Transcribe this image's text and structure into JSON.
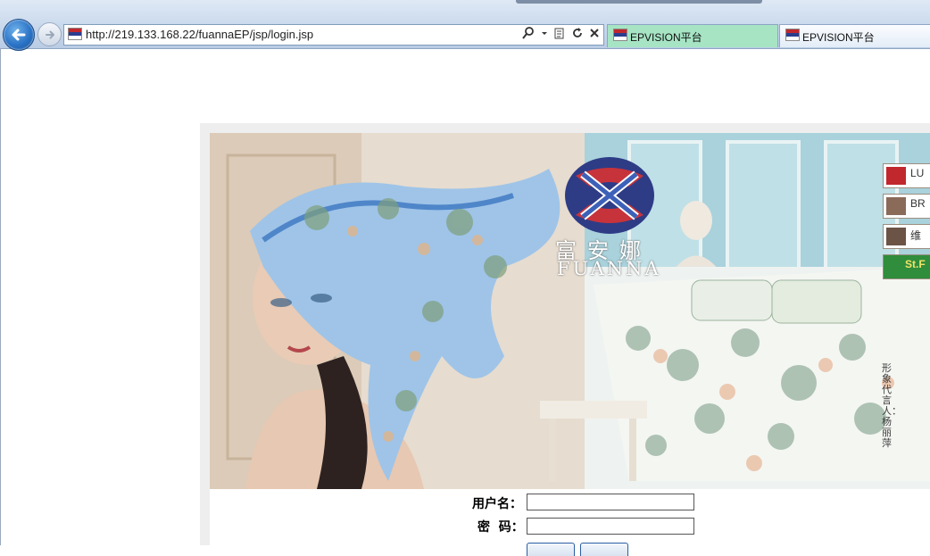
{
  "browser": {
    "address_url": "http://219.133.168.22/fuannaEP/jsp/login.jsp",
    "tabs": [
      {
        "label": "EPVISION平台"
      },
      {
        "label": "EPVISION平台"
      }
    ]
  },
  "banner": {
    "brand_name_cn": "富安娜",
    "brand_name_en": "FUANNA",
    "side_brands": [
      "LU",
      "BR",
      "维",
      "St.F"
    ],
    "vertical_caption": "形象代言人：杨丽萍"
  },
  "login_form": {
    "username_label": "用户名：",
    "password_label": "密  码：",
    "username_value": "",
    "password_value": ""
  },
  "colors": {
    "active_tab": "#a6e4c4",
    "back_button": "#2a73c6"
  }
}
